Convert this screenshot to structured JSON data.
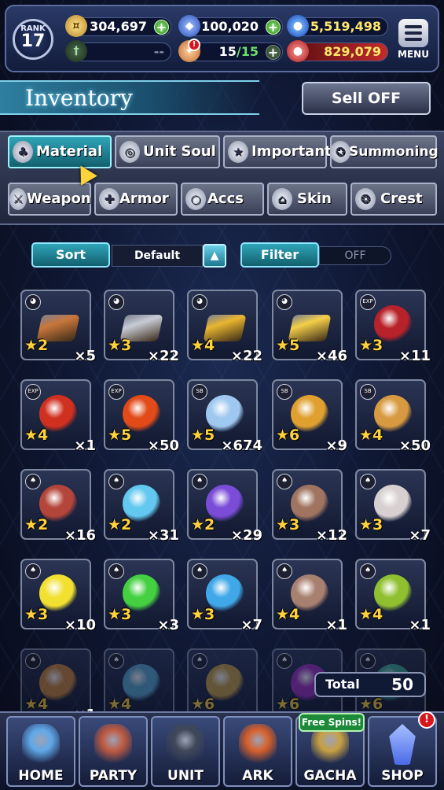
{
  "topbar": {
    "rank_label": "RANK",
    "rank_value": "17",
    "gil": "304,697",
    "lapis": "100,020",
    "blue_currency": "5,519,498",
    "guild_value": "--",
    "stamina": "15",
    "stamina_max": "/15",
    "red_currency": "829,079",
    "menu_label": "MENU",
    "colors": {
      "gil": "#f2c94c",
      "lapis": "#5d8cff",
      "blue": "#2f6dff",
      "red": "#d32a2a",
      "green": "#35b535"
    }
  },
  "header": {
    "title": "Inventory",
    "sell_label": "Sell OFF"
  },
  "tabs": {
    "row1": [
      {
        "label": "Material",
        "icon": "material-bag-icon",
        "active": true
      },
      {
        "label": "Unit Soul",
        "icon": "soul-flame-icon",
        "active": false
      },
      {
        "label": "Important",
        "icon": "star-icon",
        "active": false
      },
      {
        "label": "Summoning",
        "icon": "summon-icon",
        "active": false
      }
    ],
    "row2": [
      {
        "label": "Weapon",
        "icon": "sword-icon"
      },
      {
        "label": "Armor",
        "icon": "armor-icon"
      },
      {
        "label": "Accs",
        "icon": "ring-icon"
      },
      {
        "label": "Skin",
        "icon": "hanger-icon"
      },
      {
        "label": "Crest",
        "icon": "crest-icon"
      }
    ]
  },
  "controls": {
    "sort_label": "Sort",
    "sort_value": "Default",
    "filter_label": "Filter",
    "filter_value": "OFF"
  },
  "items": [
    {
      "rarity": "2",
      "qty": "×5",
      "badge": "◕",
      "color": "#c9773a",
      "name": "bronze-ingot"
    },
    {
      "rarity": "3",
      "qty": "×22",
      "badge": "◕",
      "color": "#c8ccd6",
      "name": "silver-ingot"
    },
    {
      "rarity": "4",
      "qty": "×22",
      "badge": "◕",
      "color": "#e8b630",
      "name": "gold-ingot"
    },
    {
      "rarity": "5",
      "qty": "×46",
      "badge": "◕",
      "color": "#f4cf48",
      "name": "gold-ingot-pile"
    },
    {
      "rarity": "3",
      "qty": "×11",
      "badge": "EXP",
      "color": "#b8222a",
      "name": "red-potion"
    },
    {
      "rarity": "4",
      "qty": "×1",
      "badge": "EXP",
      "color": "#d03020",
      "name": "red-potion-large"
    },
    {
      "rarity": "5",
      "qty": "×50",
      "badge": "EXP",
      "color": "#e24a18",
      "name": "red-vase"
    },
    {
      "rarity": "5",
      "qty": "×674",
      "badge": "SB",
      "color": "#9fc8f0",
      "name": "mirror"
    },
    {
      "rarity": "6",
      "qty": "×9",
      "badge": "SB",
      "color": "#e0a030",
      "name": "golden-relic"
    },
    {
      "rarity": "4",
      "qty": "×50",
      "badge": "SB",
      "color": "#d89a40",
      "name": "golden-urn"
    },
    {
      "rarity": "2",
      "qty": "×16",
      "badge": "♠",
      "color": "#b4453a",
      "name": "meat"
    },
    {
      "rarity": "2",
      "qty": "×31",
      "badge": "♠",
      "color": "#62c8f0",
      "name": "blue-bottle"
    },
    {
      "rarity": "2",
      "qty": "×29",
      "badge": "♠",
      "color": "#7a4cd8",
      "name": "crystal"
    },
    {
      "rarity": "3",
      "qty": "×12",
      "badge": "♠",
      "color": "#a07460",
      "name": "horn"
    },
    {
      "rarity": "3",
      "qty": "×7",
      "badge": "♠",
      "color": "#d8d0d0",
      "name": "red-gem-cloth"
    },
    {
      "rarity": "3",
      "qty": "×10",
      "badge": "♠",
      "color": "#f2e030",
      "name": "golden-apple"
    },
    {
      "rarity": "3",
      "qty": "×3",
      "badge": "♠",
      "color": "#44d040",
      "name": "green-bottle"
    },
    {
      "rarity": "3",
      "qty": "×7",
      "badge": "♠",
      "color": "#40a8e8",
      "name": "blue-bone"
    },
    {
      "rarity": "4",
      "qty": "×1",
      "badge": "♠",
      "color": "#a88070",
      "name": "rusty-plate"
    },
    {
      "rarity": "4",
      "qty": "×1",
      "badge": "♠",
      "color": "#90c030",
      "name": "green-crystal"
    },
    {
      "rarity": "4",
      "qty": "×1",
      "badge": "♠",
      "color": "#d08a40",
      "name": "orange-bottle"
    },
    {
      "rarity": "4",
      "qty": "",
      "badge": "♠",
      "color": "#5aa8d0",
      "name": "blue-orb"
    },
    {
      "rarity": "6",
      "qty": "",
      "badge": "♠",
      "color": "#c8a040",
      "name": "golden-orb"
    },
    {
      "rarity": "6",
      "qty": "",
      "badge": "♠",
      "color": "#a030c0",
      "name": "purple-orb"
    },
    {
      "rarity": "6",
      "qty": "",
      "badge": "♠",
      "color": "#40b0a0",
      "name": "teal-orb"
    }
  ],
  "total": {
    "label": "Total",
    "value": "50"
  },
  "nav": [
    {
      "label": "HOME",
      "color": "#5fa8e8",
      "icon": "home-crest-icon"
    },
    {
      "label": "PARTY",
      "color": "#c05a40",
      "icon": "party-icon"
    },
    {
      "label": "UNIT",
      "color": "#404858",
      "icon": "unit-icon"
    },
    {
      "label": "ARK",
      "color": "#d8602a",
      "icon": "ark-phoenix-icon"
    },
    {
      "label": "GACHA",
      "color": "#c8a040",
      "icon": "gacha-icon"
    },
    {
      "label": "SHOP",
      "color": "#4a6ae8",
      "icon": "shop-crystal-icon"
    }
  ],
  "free_spins": "Free Spins!",
  "alert_mark": "!"
}
